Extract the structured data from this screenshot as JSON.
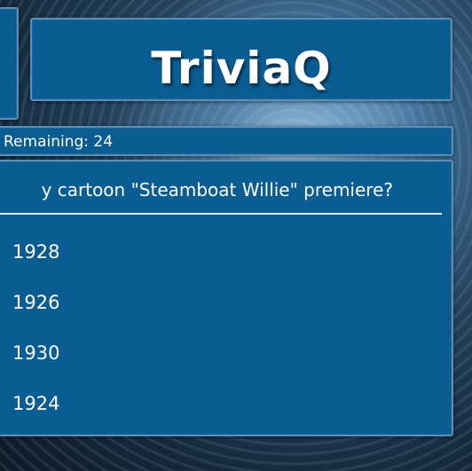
{
  "app": {
    "title": "TriviaQ"
  },
  "status": {
    "remaining_text": "Remaining: 24"
  },
  "question": {
    "text": "y cartoon \"Steamboat Willie\" premiere?"
  },
  "answers": [
    {
      "label": "1928"
    },
    {
      "label": "1926"
    },
    {
      "label": "1930"
    },
    {
      "label": "1924"
    }
  ],
  "colors": {
    "panel": "#0a5d93",
    "panel_border": "#5b8fb6",
    "text": "#ffffff"
  }
}
